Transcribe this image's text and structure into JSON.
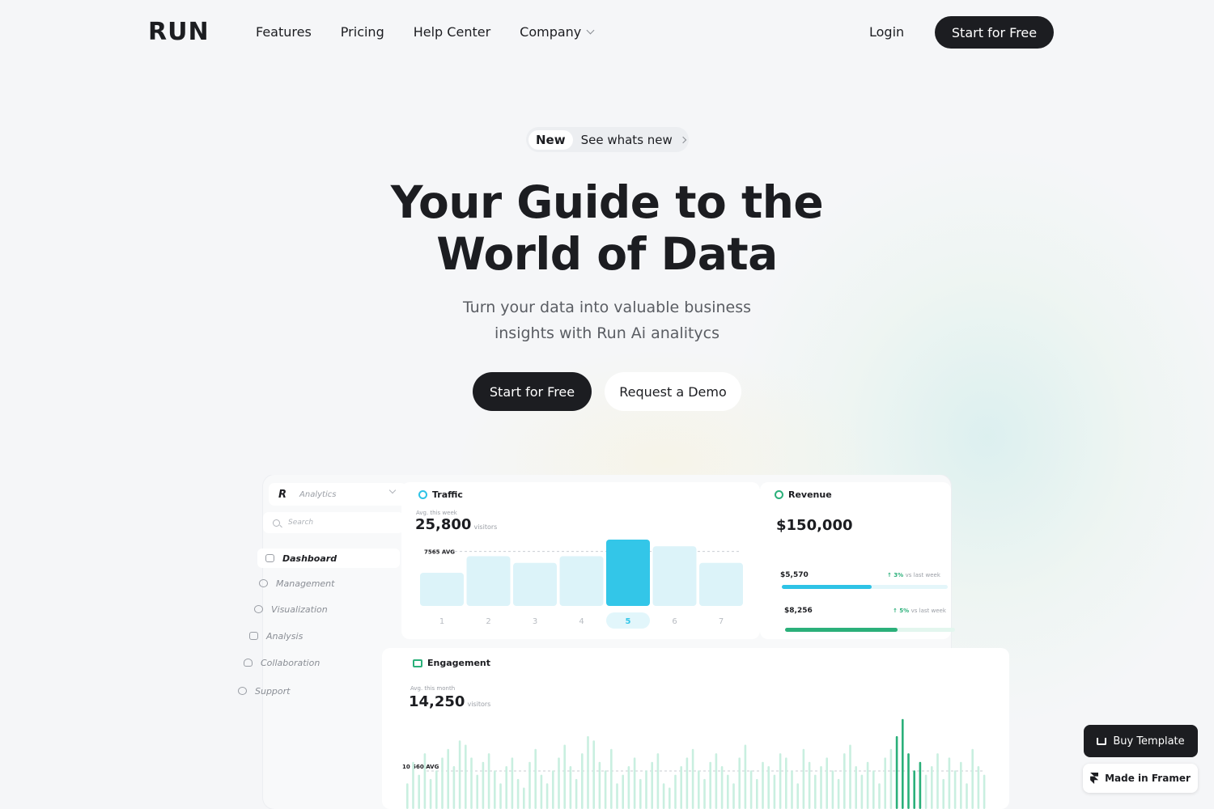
{
  "nav": {
    "logo": "RUN",
    "links": [
      "Features",
      "Pricing",
      "Help Center",
      "Company"
    ],
    "login": "Login",
    "cta": "Start for Free"
  },
  "hero": {
    "pill_new": "New",
    "pill_text": "See whats new",
    "title_line1": "Your Guide to the",
    "title_line2": "World of Data",
    "subtitle_line1": "Turn your data into valuable business",
    "subtitle_line2": "insights with Run Ai analitycs",
    "cta_primary": "Start for Free",
    "cta_secondary": "Request a Demo"
  },
  "dashboard": {
    "sidebar": {
      "brand_letter": "R",
      "selector": "Analytics",
      "search_placeholder": "Search",
      "items": [
        "Dashboard",
        "Management",
        "Visualization",
        "Analysis",
        "Collaboration",
        "Support"
      ]
    },
    "traffic": {
      "title": "Traffic",
      "caption": "Avg. this week",
      "value": "25,800",
      "unit": "visitors",
      "avg_label": "7565 AVG",
      "active_day": "5"
    },
    "revenue": {
      "title": "Revenue",
      "value": "$150,000",
      "rows": [
        {
          "amount": "$5,570",
          "change": "↑ 3%",
          "note": "vs last week",
          "progress": 0.54,
          "color": "#2ec3e6"
        },
        {
          "amount": "$8,256",
          "change": "↑ 5%",
          "note": "vs last week",
          "progress": 0.66,
          "color": "#2bb07a"
        }
      ]
    },
    "engagement": {
      "title": "Engagement",
      "caption": "Avg. this month",
      "value": "14,250",
      "unit": "visitors",
      "avg_label": "10 560 AVG"
    }
  },
  "chart_data": [
    {
      "type": "bar",
      "title": "Traffic",
      "categories": [
        "1",
        "2",
        "3",
        "4",
        "5",
        "6",
        "7"
      ],
      "values": [
        4000,
        6000,
        5200,
        6000,
        8000,
        7200,
        5200
      ],
      "avg": 7565,
      "highlight": "5",
      "colors": {
        "bar": "#dcf3f9",
        "highlight": "#33c6e8"
      }
    },
    {
      "type": "bar",
      "title": "Engagement",
      "avg": 10560,
      "values": [
        6,
        11,
        8,
        13,
        7,
        9,
        12,
        14,
        10,
        16,
        15,
        12,
        8,
        11,
        13,
        9,
        6,
        10,
        12,
        7,
        5,
        11,
        14,
        8,
        6,
        9,
        12,
        15,
        10,
        7,
        13,
        17,
        16,
        11,
        9,
        14,
        6,
        8,
        10,
        12,
        7,
        9,
        11,
        13,
        6,
        5,
        8,
        10,
        12,
        14,
        9,
        7,
        11,
        13,
        10,
        8,
        6,
        12,
        15,
        9,
        7,
        11,
        10,
        8,
        13,
        12,
        9,
        6,
        14,
        11,
        8,
        10,
        12,
        9,
        7,
        13,
        15,
        10,
        8,
        11,
        9,
        6,
        12,
        14,
        17,
        21,
        13,
        9,
        11,
        8,
        10,
        13,
        7,
        12,
        9,
        11,
        6,
        14,
        10,
        8
      ],
      "highlight_range": [
        84,
        88
      ],
      "colors": {
        "bar": "#c9efe0",
        "highlight": "#2bb07a"
      }
    }
  ]
}
